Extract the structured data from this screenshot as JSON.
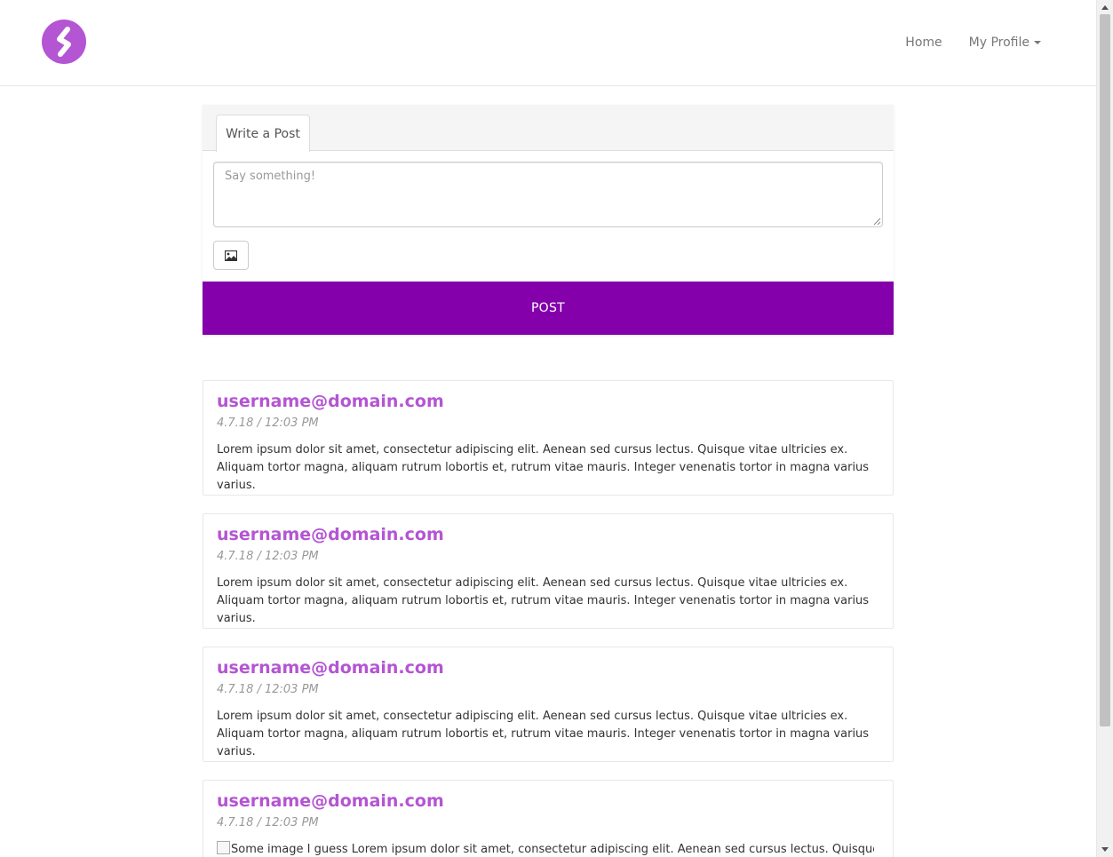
{
  "colors": {
    "brand": "#b455d3",
    "post_button": "#8300aa",
    "nav_text": "#777777"
  },
  "nav": {
    "logo_icon": "brand-logo-icon",
    "home": "Home",
    "profile": "My Profile"
  },
  "composer": {
    "tab_label": "Write a Post",
    "placeholder": "Say something!",
    "image_icon": "image-icon",
    "post_label": "POST"
  },
  "posts": [
    {
      "author": "username@domain.com",
      "time": "4.7.18 / 12:03 PM",
      "body": "Lorem ipsum dolor sit amet, consectetur adipiscing elit. Aenean sed cursus lectus. Quisque vitae ultricies ex. Aliquam tortor magna, aliquam rutrum lobortis et, rutrum vitae mauris. Integer venenatis tortor in magna varius varius."
    },
    {
      "author": "username@domain.com",
      "time": "4.7.18 / 12:03 PM",
      "body": "Lorem ipsum dolor sit amet, consectetur adipiscing elit. Aenean sed cursus lectus. Quisque vitae ultricies ex. Aliquam tortor magna, aliquam rutrum lobortis et, rutrum vitae mauris. Integer venenatis tortor in magna varius varius."
    },
    {
      "author": "username@domain.com",
      "time": "4.7.18 / 12:03 PM",
      "body": "Lorem ipsum dolor sit amet, consectetur adipiscing elit. Aenean sed cursus lectus. Quisque vitae ultricies ex. Aliquam tortor magna, aliquam rutrum lobortis et, rutrum vitae mauris. Integer venenatis tortor in magna varius varius."
    },
    {
      "author": "username@domain.com",
      "time": "4.7.18 / 12:03 PM",
      "image_alt": "Some image I guess",
      "body": "Lorem ipsum dolor sit amet, consectetur adipiscing elit. Aenean sed cursus lectus. Quisque vitae"
    }
  ]
}
